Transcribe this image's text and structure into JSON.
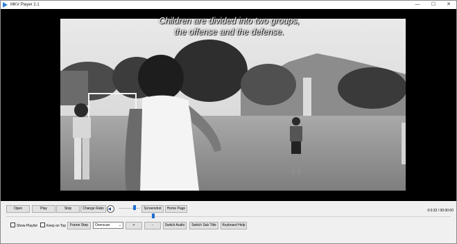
{
  "window": {
    "title": "MKV Player 2.1",
    "minimize_glyph": "—",
    "maximize_glyph": "☐",
    "close_glyph": "✕"
  },
  "subtitle": {
    "line1": "Children are divided into two groups,",
    "line2": "the offense and the defense."
  },
  "controls": {
    "open": "Open",
    "play": "Play",
    "stop": "Stop",
    "change_ratio": "Change Ratio",
    "screenshot": "Screenshot",
    "home_page": "Home Page",
    "show_playlist": "Show Playlist",
    "keep_on_top": "Keep on Top",
    "frame_step": "Frame Step",
    "overscan": "Overscan",
    "plus": "+",
    "minus": "-",
    "switch_audio": "Switch Audio",
    "switch_sub_title": "Switch Sub Title",
    "keyboard_help": "Keyboard Help",
    "time": "0:0:32 / 00:00:00",
    "volume_level": 0.75,
    "position_level": 0.33
  },
  "colors": {
    "accent": "#1e6fd0",
    "video_bg": "#000000",
    "panel_bg": "#f0f0f0"
  }
}
